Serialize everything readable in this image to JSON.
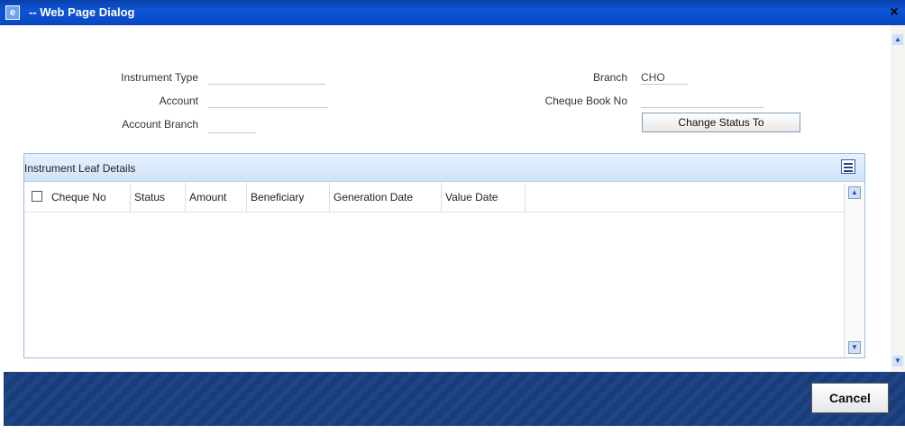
{
  "window": {
    "title": "-- Web Page Dialog",
    "close_glyph": "×"
  },
  "form": {
    "instrument_type_label": "Instrument Type",
    "instrument_type_value": "",
    "account_label": "Account",
    "account_value": "",
    "account_branch_label": "Account Branch",
    "account_branch_value": "",
    "branch_label": "Branch",
    "branch_value": "CHO",
    "cheque_book_label": "Cheque Book No",
    "cheque_book_value": "",
    "change_status_label": "Change Status To"
  },
  "grid": {
    "title": "Instrument Leaf Details",
    "columns": [
      "Cheque No",
      "Status",
      "Amount",
      "Beneficiary",
      "Generation Date",
      "Value Date"
    ],
    "rows": []
  },
  "footer": {
    "cancel_label": "Cancel"
  },
  "icons": {
    "app": "ie-dialog-icon",
    "grid": "list-view-icon"
  }
}
